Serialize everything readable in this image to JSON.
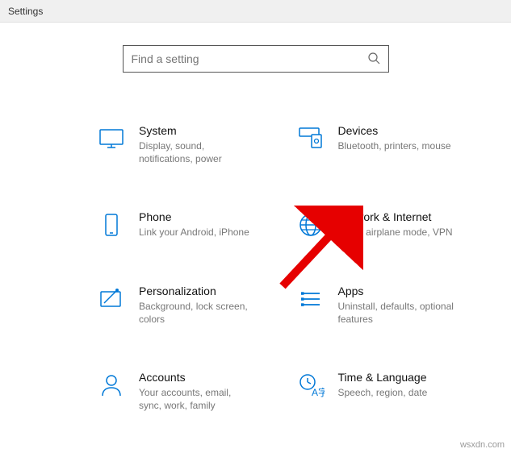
{
  "window": {
    "title": "Settings"
  },
  "search": {
    "placeholder": "Find a setting"
  },
  "categories": [
    {
      "id": "system",
      "title": "System",
      "desc": "Display, sound, notifications, power"
    },
    {
      "id": "devices",
      "title": "Devices",
      "desc": "Bluetooth, printers, mouse"
    },
    {
      "id": "phone",
      "title": "Phone",
      "desc": "Link your Android, iPhone"
    },
    {
      "id": "network",
      "title": "Network & Internet",
      "desc": "Wi-Fi, airplane mode, VPN"
    },
    {
      "id": "personalization",
      "title": "Personalization",
      "desc": "Background, lock screen, colors"
    },
    {
      "id": "apps",
      "title": "Apps",
      "desc": "Uninstall, defaults, optional features"
    },
    {
      "id": "accounts",
      "title": "Accounts",
      "desc": "Your accounts, email, sync, work, family"
    },
    {
      "id": "time-language",
      "title": "Time & Language",
      "desc": "Speech, region, date"
    }
  ],
  "watermark": "wsxdn.com"
}
